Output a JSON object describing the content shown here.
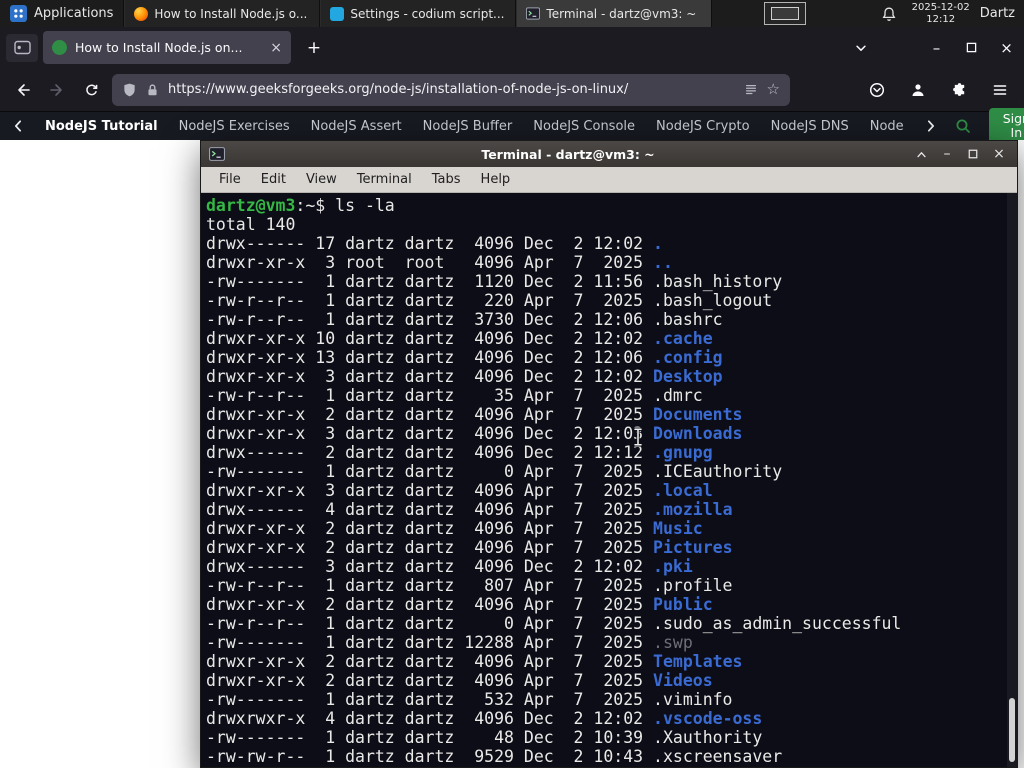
{
  "panel": {
    "applications_label": "Applications",
    "taskbar": [
      {
        "title": "How to Install Node.js o..."
      },
      {
        "title": "Settings - codium script..."
      },
      {
        "title": "Terminal - dartz@vm3: ~"
      }
    ],
    "clock": {
      "date": "2025-12-02",
      "time": "12:12"
    },
    "user_label": "Dartz"
  },
  "browser": {
    "tab_title": "How to Install Node.js on...",
    "url": "https://www.geeksforgeeks.org/node-js/installation-of-node-js-on-linux/"
  },
  "site_nav": {
    "items": [
      "NodeJS Tutorial",
      "NodeJS Exercises",
      "NodeJS Assert",
      "NodeJS Buffer",
      "NodeJS Console",
      "NodeJS Crypto",
      "NodeJS DNS",
      "Node"
    ],
    "sign_in_label": "Sign In"
  },
  "terminal_window": {
    "title": "Terminal - dartz@vm3: ~",
    "menu": [
      "File",
      "Edit",
      "View",
      "Terminal",
      "Tabs",
      "Help"
    ],
    "prompt_user_host": "dartz@vm3",
    "prompt_separator": ":~$",
    "command": "ls -la",
    "total_line": "total 140",
    "listing": [
      {
        "perms": "drwx------",
        "links": "17",
        "owner": "dartz",
        "group": "dartz",
        "size": "4096",
        "month": "Dec",
        "day": "2",
        "time_or_year": "12:02",
        "name": ".",
        "kind": "dir"
      },
      {
        "perms": "drwxr-xr-x",
        "links": "3",
        "owner": "root",
        "group": "root",
        "size": "4096",
        "month": "Apr",
        "day": "7",
        "time_or_year": "2025",
        "name": "..",
        "kind": "dir"
      },
      {
        "perms": "-rw-------",
        "links": "1",
        "owner": "dartz",
        "group": "dartz",
        "size": "1120",
        "month": "Dec",
        "day": "2",
        "time_or_year": "11:56",
        "name": ".bash_history",
        "kind": "file"
      },
      {
        "perms": "-rw-r--r--",
        "links": "1",
        "owner": "dartz",
        "group": "dartz",
        "size": "220",
        "month": "Apr",
        "day": "7",
        "time_or_year": "2025",
        "name": ".bash_logout",
        "kind": "file"
      },
      {
        "perms": "-rw-r--r--",
        "links": "1",
        "owner": "dartz",
        "group": "dartz",
        "size": "3730",
        "month": "Dec",
        "day": "2",
        "time_or_year": "12:06",
        "name": ".bashrc",
        "kind": "file"
      },
      {
        "perms": "drwxr-xr-x",
        "links": "10",
        "owner": "dartz",
        "group": "dartz",
        "size": "4096",
        "month": "Dec",
        "day": "2",
        "time_or_year": "12:02",
        "name": ".cache",
        "kind": "dir"
      },
      {
        "perms": "drwxr-xr-x",
        "links": "13",
        "owner": "dartz",
        "group": "dartz",
        "size": "4096",
        "month": "Dec",
        "day": "2",
        "time_or_year": "12:06",
        "name": ".config",
        "kind": "dir"
      },
      {
        "perms": "drwxr-xr-x",
        "links": "3",
        "owner": "dartz",
        "group": "dartz",
        "size": "4096",
        "month": "Dec",
        "day": "2",
        "time_or_year": "12:02",
        "name": "Desktop",
        "kind": "dir"
      },
      {
        "perms": "-rw-r--r--",
        "links": "1",
        "owner": "dartz",
        "group": "dartz",
        "size": "35",
        "month": "Apr",
        "day": "7",
        "time_or_year": "2025",
        "name": ".dmrc",
        "kind": "file"
      },
      {
        "perms": "drwxr-xr-x",
        "links": "2",
        "owner": "dartz",
        "group": "dartz",
        "size": "4096",
        "month": "Apr",
        "day": "7",
        "time_or_year": "2025",
        "name": "Documents",
        "kind": "dir"
      },
      {
        "perms": "drwxr-xr-x",
        "links": "3",
        "owner": "dartz",
        "group": "dartz",
        "size": "4096",
        "month": "Dec",
        "day": "2",
        "time_or_year": "12:03",
        "name": "Downloads",
        "kind": "dir"
      },
      {
        "perms": "drwx------",
        "links": "2",
        "owner": "dartz",
        "group": "dartz",
        "size": "4096",
        "month": "Dec",
        "day": "2",
        "time_or_year": "12:12",
        "name": ".gnupg",
        "kind": "dir"
      },
      {
        "perms": "-rw-------",
        "links": "1",
        "owner": "dartz",
        "group": "dartz",
        "size": "0",
        "month": "Apr",
        "day": "7",
        "time_or_year": "2025",
        "name": ".ICEauthority",
        "kind": "file"
      },
      {
        "perms": "drwxr-xr-x",
        "links": "3",
        "owner": "dartz",
        "group": "dartz",
        "size": "4096",
        "month": "Apr",
        "day": "7",
        "time_or_year": "2025",
        "name": ".local",
        "kind": "dir"
      },
      {
        "perms": "drwx------",
        "links": "4",
        "owner": "dartz",
        "group": "dartz",
        "size": "4096",
        "month": "Apr",
        "day": "7",
        "time_or_year": "2025",
        "name": ".mozilla",
        "kind": "dir"
      },
      {
        "perms": "drwxr-xr-x",
        "links": "2",
        "owner": "dartz",
        "group": "dartz",
        "size": "4096",
        "month": "Apr",
        "day": "7",
        "time_or_year": "2025",
        "name": "Music",
        "kind": "dir"
      },
      {
        "perms": "drwxr-xr-x",
        "links": "2",
        "owner": "dartz",
        "group": "dartz",
        "size": "4096",
        "month": "Apr",
        "day": "7",
        "time_or_year": "2025",
        "name": "Pictures",
        "kind": "dir"
      },
      {
        "perms": "drwx------",
        "links": "3",
        "owner": "dartz",
        "group": "dartz",
        "size": "4096",
        "month": "Dec",
        "day": "2",
        "time_or_year": "12:02",
        "name": ".pki",
        "kind": "dir"
      },
      {
        "perms": "-rw-r--r--",
        "links": "1",
        "owner": "dartz",
        "group": "dartz",
        "size": "807",
        "month": "Apr",
        "day": "7",
        "time_or_year": "2025",
        "name": ".profile",
        "kind": "file"
      },
      {
        "perms": "drwxr-xr-x",
        "links": "2",
        "owner": "dartz",
        "group": "dartz",
        "size": "4096",
        "month": "Apr",
        "day": "7",
        "time_or_year": "2025",
        "name": "Public",
        "kind": "dir"
      },
      {
        "perms": "-rw-r--r--",
        "links": "1",
        "owner": "dartz",
        "group": "dartz",
        "size": "0",
        "month": "Apr",
        "day": "7",
        "time_or_year": "2025",
        "name": ".sudo_as_admin_successful",
        "kind": "file"
      },
      {
        "perms": "-rw-------",
        "links": "1",
        "owner": "dartz",
        "group": "dartz",
        "size": "12288",
        "month": "Apr",
        "day": "7",
        "time_or_year": "2025",
        "name": ".swp",
        "kind": "dim"
      },
      {
        "perms": "drwxr-xr-x",
        "links": "2",
        "owner": "dartz",
        "group": "dartz",
        "size": "4096",
        "month": "Apr",
        "day": "7",
        "time_or_year": "2025",
        "name": "Templates",
        "kind": "dir"
      },
      {
        "perms": "drwxr-xr-x",
        "links": "2",
        "owner": "dartz",
        "group": "dartz",
        "size": "4096",
        "month": "Apr",
        "day": "7",
        "time_or_year": "2025",
        "name": "Videos",
        "kind": "dir"
      },
      {
        "perms": "-rw-------",
        "links": "1",
        "owner": "dartz",
        "group": "dartz",
        "size": "532",
        "month": "Apr",
        "day": "7",
        "time_or_year": "2025",
        "name": ".viminfo",
        "kind": "file"
      },
      {
        "perms": "drwxrwxr-x",
        "links": "4",
        "owner": "dartz",
        "group": "dartz",
        "size": "4096",
        "month": "Dec",
        "day": "2",
        "time_or_year": "12:02",
        "name": ".vscode-oss",
        "kind": "dir"
      },
      {
        "perms": "-rw-------",
        "links": "1",
        "owner": "dartz",
        "group": "dartz",
        "size": "48",
        "month": "Dec",
        "day": "2",
        "time_or_year": "10:39",
        "name": ".Xauthority",
        "kind": "file"
      },
      {
        "perms": "-rw-rw-r--",
        "links": "1",
        "owner": "dartz",
        "group": "dartz",
        "size": "9529",
        "month": "Dec",
        "day": "2",
        "time_or_year": "10:43",
        "name": ".xscreensaver",
        "kind": "file"
      }
    ]
  },
  "glyphs": {
    "close": "×",
    "plus": "+",
    "minimize": "–",
    "star": "☆"
  },
  "colors": {
    "gfg_green": "#2f8d46",
    "panel_background": "#1c1c1c",
    "firefox_chrome": "#1c1b22",
    "firefox_field": "#42414d",
    "sitenav_background": "#171a21",
    "terminal_background": "#0d0d17",
    "terminal_foreground": "#e9e9e7",
    "terminal_green": "#35b844",
    "terminal_blue": "#3a6bd3",
    "terminal_dim": "#6e6e78"
  }
}
